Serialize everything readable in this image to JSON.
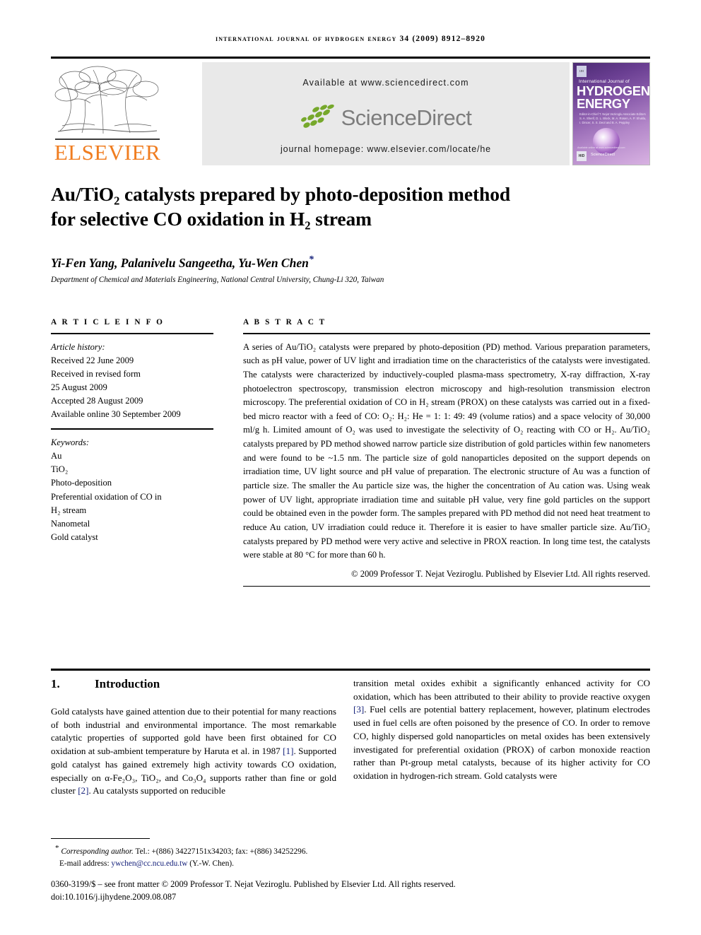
{
  "running_head": "International Journal of Hydrogen Energy 34 (2009) 8912–8920",
  "header": {
    "publisher_name": "ELSEVIER",
    "available_at": "Available at www.sciencedirect.com",
    "sciencedirect_logo_text": "ScienceDirect",
    "journal_homepage": "journal homepage: www.elsevier.com/locate/he",
    "cover": {
      "small_title": "International Journal of",
      "line1": "HYDROGEN",
      "line2": "ENERGY",
      "editors": "Editor-in-Chief  T. Nejat Veziroglu    Associate Editors  S. A. Sherif, D. L. Block, M. A. Rosen, A. P. Shukla, I. Dincer, S. S. Deol and B. A. Peppley",
      "availability": "Available online at www.sciencedirect.com",
      "hid_badge": "HID",
      "ijl_badge": "IJH",
      "sciencedirect_badge": "ScienceDirect"
    }
  },
  "article": {
    "title_line1": "Au/TiO₂ catalysts prepared by photo-deposition method",
    "title_line2": "for selective CO oxidation in H₂ stream",
    "authors": "Yi-Fen Yang, Palanivelu Sangeetha, Yu-Wen Chen",
    "author_star": "*",
    "affiliation": "Department of Chemical and Materials Engineering, National Central University, Chung-Li 320, Taiwan"
  },
  "article_info": {
    "heading": "A R T I C L E   I N F O",
    "history_label": "Article history:",
    "history": [
      "Received 22 June 2009",
      "Received in revised form",
      "25 August 2009",
      "Accepted 28 August 2009",
      "Available online 30 September 2009"
    ],
    "keywords_label": "Keywords:",
    "keywords": [
      "Au",
      "TiO₂",
      "Photo-deposition",
      "Preferential oxidation of CO in",
      "H₂ stream",
      "Nanometal",
      "Gold catalyst"
    ]
  },
  "abstract": {
    "heading": "A B S T R A C T",
    "text": "A series of Au/TiO₂ catalysts were prepared by photo-deposition (PD) method. Various preparation parameters, such as pH value, power of UV light and irradiation time on the characteristics of the catalysts were investigated. The catalysts were characterized by inductively-coupled plasma-mass spectrometry, X-ray diffraction, X-ray photoelectron spectroscopy, transmission electron microscopy and high-resolution transmission electron microscopy. The preferential oxidation of CO in H₂ stream (PROX) on these catalysts was carried out in a fixed-bed micro reactor with a feed of CO: O₂: H₂: He = 1: 1: 49: 49 (volume ratios) and a space velocity of 30,000 ml/g h. Limited amount of O₂ was used to investigate the selectivity of O₂ reacting with CO or H₂. Au/TiO₂ catalysts prepared by PD method showed narrow particle size distribution of gold particles within few nanometers and were found to be ~1.5 nm. The particle size of gold nanoparticles deposited on the support depends on irradiation time, UV light source and pH value of preparation. The electronic structure of Au was a function of particle size. The smaller the Au particle size was, the higher the concentration of Au cation was. Using weak power of UV light, appropriate irradiation time and suitable pH value, very fine gold particles on the support could be obtained even in the powder form. The samples prepared with PD method did not need heat treatment to reduce Au cation, UV irradiation could reduce it. Therefore it is easier to have smaller particle size. Au/TiO₂ catalysts prepared by PD method were very active and selective in PROX reaction. In long time test, the catalysts were stable at 80 °C for more than 60 h.",
    "copyright": "© 2009 Professor T. Nejat Veziroglu. Published by Elsevier Ltd. All rights reserved."
  },
  "introduction": {
    "number": "1.",
    "heading": "Introduction",
    "left_column_part1": "Gold catalysts have gained attention due to their potential for many reactions of both industrial and environmental importance. The most remarkable catalytic properties of supported gold have been first obtained for CO oxidation at sub-ambient temperature by Haruta et al. in 1987 ",
    "ref1": "[1]",
    "left_column_part2": ". Supported gold catalyst has gained extremely high activity towards CO oxidation, especially on α-Fe₂O₃, TiO₂, and Co₃O₄ supports rather than fine or gold cluster ",
    "ref2": "[2]",
    "left_column_part3": ". Au catalysts supported on reducible",
    "right_column_part1": "transition metal oxides exhibit a significantly enhanced activity for CO oxidation, which has been attributed to their ability to provide reactive oxygen ",
    "ref3": "[3]",
    "right_column_part2": ". Fuel cells are potential battery replacement, however, platinum electrodes used in fuel cells are often poisoned by the presence of CO. In order to remove CO, highly dispersed gold nanoparticles on metal oxides has been extensively investigated for preferential oxidation (PROX) of carbon monoxide reaction rather than Pt-group metal catalysts, because of its higher activity for CO oxidation in hydrogen-rich stream. Gold catalysts were"
  },
  "footer": {
    "corresponding_label": "Corresponding author.",
    "corresponding_contact": " Tel.: +(886) 34227151x34203; fax: +(886) 34252296.",
    "email_label": "E-mail address: ",
    "email": "ywchen@cc.ncu.edu.tw",
    "email_suffix": " (Y.-W. Chen).",
    "front_matter": "0360-3199/$ – see front matter © 2009 Professor T. Nejat Veziroglu. Published by Elsevier Ltd. All rights reserved.",
    "doi": "doi:10.1016/j.ijhydene.2009.08.087"
  },
  "colors": {
    "elsevier_orange": "#F07D20",
    "sciencedirect_green": "#76A82B",
    "sciencedirect_gray": "#7d7d7d",
    "link_blue": "#14207a",
    "band_gray": "#e9e9e9"
  }
}
